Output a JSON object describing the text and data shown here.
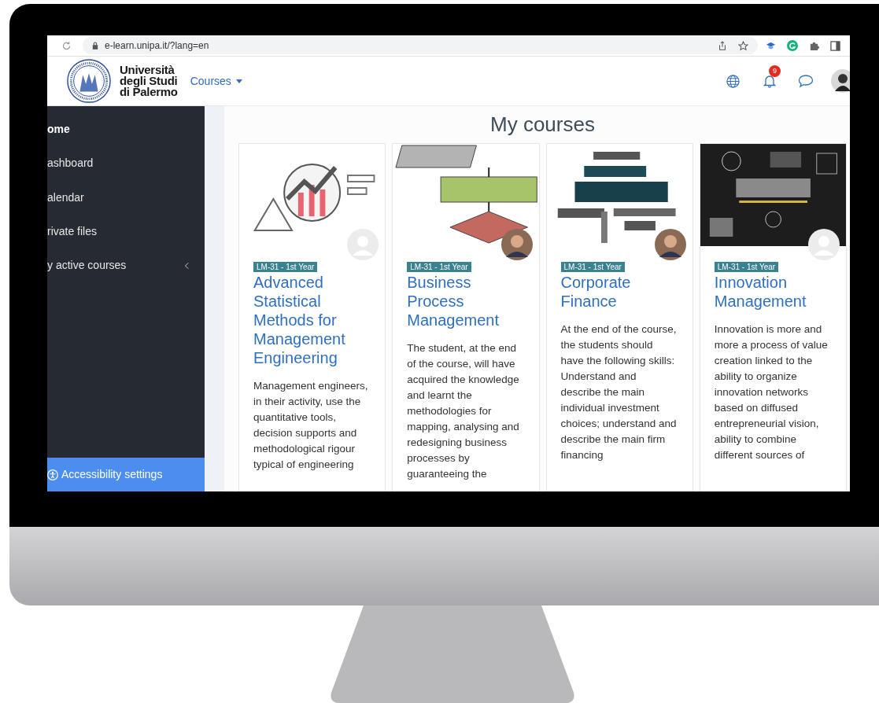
{
  "browser": {
    "url": "e-learn.unipa.it/?lang=en"
  },
  "header": {
    "logo_lines": [
      "Università",
      "degli Studi",
      "di Palermo"
    ],
    "nav_menu": "Courses",
    "notification_count": "9"
  },
  "sidebar": {
    "items": [
      {
        "label": "ome",
        "selected": true
      },
      {
        "label": "ashboard",
        "selected": false
      },
      {
        "label": "alendar",
        "selected": false
      },
      {
        "label": "rivate files",
        "selected": false
      },
      {
        "label": "y active courses",
        "selected": false,
        "expandable": true
      }
    ],
    "accessibility_button": "Accessibility settings"
  },
  "main": {
    "title": "My courses",
    "courses": [
      {
        "badge": "LM-31 - 1st Year",
        "title": "Advanced Statistical Methods for Management Engineering",
        "description": "Management engineers, in their activity, use the quantitative tools, decision supports and methodological rigour typical of engineering",
        "kind": "placeholder"
      },
      {
        "badge": "LM-31 - 1st Year",
        "title": "Business Process Management",
        "description": "The student, at the end of the course, will have acquired the knowledge and learnt the methodologies for mapping, analysing and redesigning business processes by guaranteeing the"
      },
      {
        "badge": "LM-31 - 1st Year",
        "title": "Corporate Finance",
        "description": "At the end of the course, the students should have the following skills: Understand and describe the main individual investment choices; understand and describe the main firm financing"
      },
      {
        "badge": "LM-31 - 1st Year",
        "title": "Innovation Management",
        "description": "Innovation is more and more a process of value creation linked to the ability to organize innovation networks based on diffused entrepreneurial vision, ability to combine different sources of",
        "kind": "placeholder"
      }
    ]
  }
}
